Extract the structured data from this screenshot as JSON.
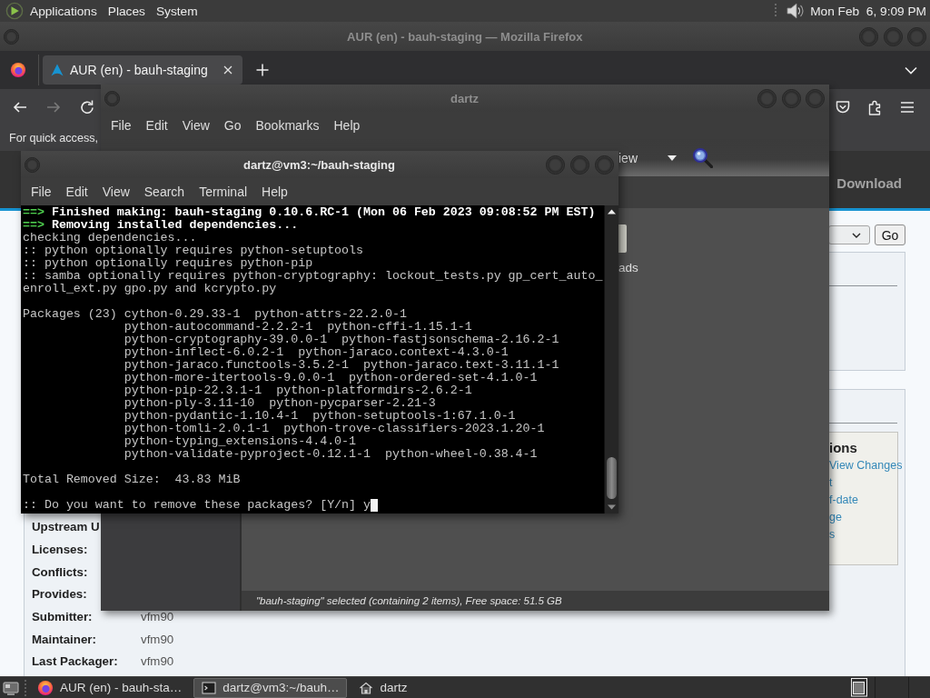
{
  "top_panel": {
    "menus": [
      "Applications",
      "Places",
      "System"
    ],
    "clock": "Mon Feb  6, 9:09 PM"
  },
  "browser": {
    "title": "AUR (en) - bauh-staging — Mozilla Firefox",
    "active": false,
    "tabs": [
      {
        "label": "AUR (en) - bauh-staging",
        "selected": true
      }
    ],
    "nav_buttons": [
      {
        "kind": "back",
        "disabled": false
      },
      {
        "kind": "forward",
        "disabled": true
      },
      {
        "kind": "reload",
        "disabled": false
      }
    ],
    "bookmarks_hint": "For quick access,",
    "page": {
      "nav_link": "Download",
      "go_button": "Go",
      "details": [
        {
          "label": "Upstream U"
        },
        {
          "label": "Licenses:"
        },
        {
          "label": "Conflicts:"
        },
        {
          "label": "Provides:"
        },
        {
          "label": "Submitter:",
          "value": "vfm90"
        },
        {
          "label": "Maintainer:",
          "value": "vfm90"
        },
        {
          "label": "Last Packager:",
          "value": "vfm90"
        }
      ],
      "actions": {
        "heading": "ions",
        "links": [
          "View Changes",
          "t",
          "f-date",
          "ge",
          "s"
        ]
      }
    }
  },
  "file_manager": {
    "title": "dartz",
    "active": false,
    "menus": [
      "File",
      "Edit",
      "View",
      "Go",
      "Bookmarks",
      "Help"
    ],
    "view_selector": "iew",
    "items": [
      {
        "label": "ads"
      }
    ],
    "status": "\"bauh-staging\" selected (containing 2 items), Free space: 51.5 GB"
  },
  "terminal": {
    "title": "dartz@vm3:~/bauh-staging",
    "active": true,
    "menus": [
      "File",
      "Edit",
      "View",
      "Search",
      "Terminal",
      "Help"
    ],
    "blocks": [
      {
        "lines": [
          {
            "marker": "==>",
            "text": "Finished making: bauh-staging 0.10.6.RC-1 (Mon 06 Feb 2023 09:08:52 PM EST)",
            "bold": true
          },
          {
            "marker": "==>",
            "text": "Removing installed dependencies...",
            "bold": true
          },
          {
            "text": "checking dependencies...",
            "bold": false
          },
          {
            "text": ":: python optionally requires python-setuptools",
            "bold": false
          },
          {
            "text": ":: python optionally requires python-pip",
            "bold": false
          },
          {
            "text": ":: samba optionally requires python-cryptography: lockout_tests.py gp_cert_auto_",
            "bold": false
          },
          {
            "text": "enroll_ext.py gpo.py and kcrypto.py",
            "bold": false
          }
        ]
      },
      {
        "label": "Packages (23)",
        "lines": [
          {
            "text": "cython-0.29.33-1  python-attrs-22.2.0-1",
            "bold": false
          },
          {
            "text": "python-autocommand-2.2.2-1  python-cffi-1.15.1-1",
            "bold": false
          },
          {
            "text": "python-cryptography-39.0.0-1  python-fastjsonschema-2.16.2-1",
            "bold": false
          },
          {
            "text": "python-inflect-6.0.2-1  python-jaraco.context-4.3.0-1",
            "bold": false
          },
          {
            "text": "python-jaraco.functools-3.5.2-1  python-jaraco.text-3.11.1-1",
            "bold": false
          },
          {
            "text": "python-more-itertools-9.0.0-1  python-ordered-set-4.1.0-1",
            "bold": false
          },
          {
            "text": "python-pip-22.3.1-1  python-platformdirs-2.6.2-1",
            "bold": false
          },
          {
            "text": "python-ply-3.11-10  python-pycparser-2.21-3",
            "bold": false
          },
          {
            "text": "python-pydantic-1.10.4-1  python-setuptools-1:67.1.0-1",
            "bold": false
          },
          {
            "text": "python-tomli-2.0.1-1  python-trove-classifiers-2023.1.20-1",
            "bold": false
          },
          {
            "text": "python-typing_extensions-4.4.0-1",
            "bold": false
          },
          {
            "text": "python-validate-pyproject-0.12.1-1  python-wheel-0.38.4-1",
            "bold": false
          }
        ]
      },
      {
        "lines": [
          {
            "text": "Total Removed Size:  43.83 MiB",
            "bold": false
          }
        ]
      },
      {
        "lines": [
          {
            "text": ":: Do you want to remove these packages? [Y/n] y",
            "bold": false
          }
        ],
        "cursor": true
      }
    ]
  },
  "taskbar": {
    "tasks": [
      {
        "kind": "browser",
        "label": "AUR (en) - bauh-sta…",
        "selected": false
      },
      {
        "kind": "terminal",
        "label": "dartz@vm3:~/bauh…",
        "selected": true
      },
      {
        "kind": "folder",
        "label": "dartz",
        "selected": false
      }
    ]
  }
}
